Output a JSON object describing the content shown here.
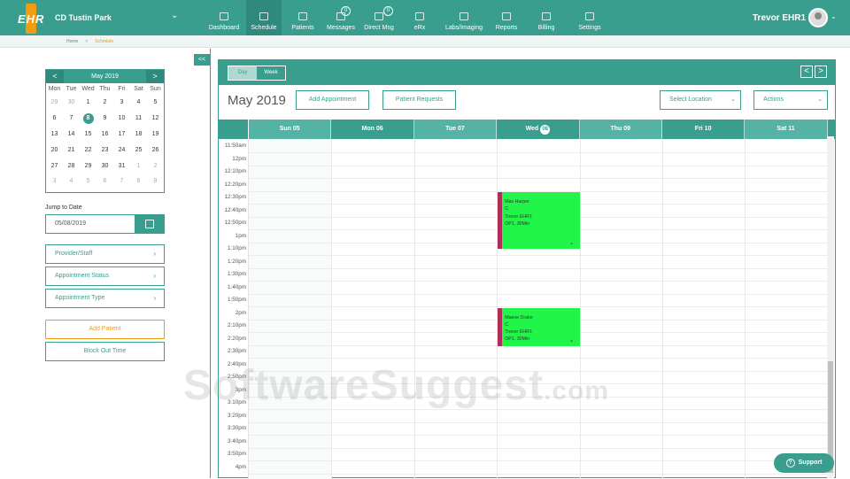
{
  "app": {
    "logo_text": "EHR",
    "clinic": "CD Tustin Park",
    "user": "Trevor EHR1"
  },
  "nav": [
    {
      "label": "Dashboard",
      "icon": "dashboard-icon",
      "badge": ""
    },
    {
      "label": "Schedule",
      "icon": "calendar-icon",
      "badge": ""
    },
    {
      "label": "Patients",
      "icon": "users-icon",
      "badge": ""
    },
    {
      "label": "Messages",
      "icon": "chat-icon",
      "badge": "0"
    },
    {
      "label": "Direct Msg",
      "icon": "envelope-icon",
      "badge": "0"
    },
    {
      "label": "eRx",
      "icon": "pen-icon",
      "badge": ""
    },
    {
      "label": "Labs/Imaging",
      "icon": "flask-icon",
      "badge": ""
    },
    {
      "label": "Reports",
      "icon": "bar-chart-icon",
      "badge": ""
    },
    {
      "label": "Billing",
      "icon": "billing-icon",
      "badge": ""
    },
    {
      "label": "Settings",
      "icon": "gear-icon",
      "badge": ""
    }
  ],
  "breadcrumb": {
    "home": "Home",
    "sep": ">",
    "current": "Schedule"
  },
  "sidebar": {
    "collapse": "<<",
    "mini_cal": {
      "title": "May 2019",
      "prev": "<",
      "next": ">",
      "dow": [
        "Mon",
        "Tue",
        "Wed",
        "Thu",
        "Fri",
        "Sat",
        "Sun"
      ],
      "weeks": [
        [
          "29",
          "30",
          "1",
          "2",
          "3",
          "4",
          "5"
        ],
        [
          "6",
          "7",
          "8",
          "9",
          "10",
          "11",
          "12"
        ],
        [
          "13",
          "14",
          "15",
          "16",
          "17",
          "18",
          "19"
        ],
        [
          "20",
          "21",
          "22",
          "23",
          "24",
          "25",
          "26"
        ],
        [
          "27",
          "28",
          "29",
          "30",
          "31",
          "1",
          "2"
        ],
        [
          "3",
          "4",
          "5",
          "6",
          "7",
          "8",
          "9"
        ]
      ],
      "selected": "8"
    },
    "jump_label": "Jump to Date",
    "jump_value": "05/08/2019",
    "filters": [
      "Provider/Staff",
      "Appointment Status",
      "Appointment Type"
    ],
    "add_patient": "Add Patient",
    "block_out": "Block Out Time"
  },
  "main": {
    "view_day": "Day",
    "view_week": "Week",
    "prev": "<",
    "next": ">",
    "month": "May 2019",
    "add_appointment": "Add Appointment",
    "patient_requests": "Patient Requests",
    "select_location": "Select Location",
    "actions": "Actions",
    "days": [
      {
        "label": "Sun 05",
        "num": ""
      },
      {
        "label": "Mon 06",
        "num": ""
      },
      {
        "label": "Tue 07",
        "num": ""
      },
      {
        "label": "Wed",
        "num": "08"
      },
      {
        "label": "Thu 09",
        "num": ""
      },
      {
        "label": "Fri 10",
        "num": ""
      },
      {
        "label": "Sat 11",
        "num": ""
      }
    ],
    "times": [
      "11:50am",
      "12pm",
      "12:10pm",
      "12:20pm",
      "12:30pm",
      "12:40pm",
      "12:50pm",
      "1pm",
      "1:10pm",
      "1:20pm",
      "1:30pm",
      "1:40pm",
      "1:50pm",
      "2pm",
      "2:10pm",
      "2:20pm",
      "2:30pm",
      "2:40pm",
      "2:50pm",
      "3pm",
      "3:10pm",
      "3:20pm",
      "3:30pm",
      "3:40pm",
      "3:50pm",
      "4pm"
    ],
    "appointments": [
      {
        "name": "Max Harper",
        "status": "C",
        "provider": "Trevor EHR1",
        "type": "OP1, 30Min",
        "day_index": 3,
        "start": "12:30pm",
        "end": "1:10pm"
      },
      {
        "name": "Maeve Drake",
        "status": "C",
        "provider": "Trevor EHR1",
        "type": "OP1, 30Min",
        "day_index": 3,
        "start": "2pm",
        "end": "2:30pm"
      }
    ]
  },
  "watermark": {
    "main": "SoftwareSuggest",
    "suffix": ".com"
  },
  "support": "Support",
  "colors": {
    "teal": "#3a9e8f",
    "orange": "#f39c12",
    "appointment": "#22f54a",
    "appointment_marker": "#b02c5a"
  }
}
